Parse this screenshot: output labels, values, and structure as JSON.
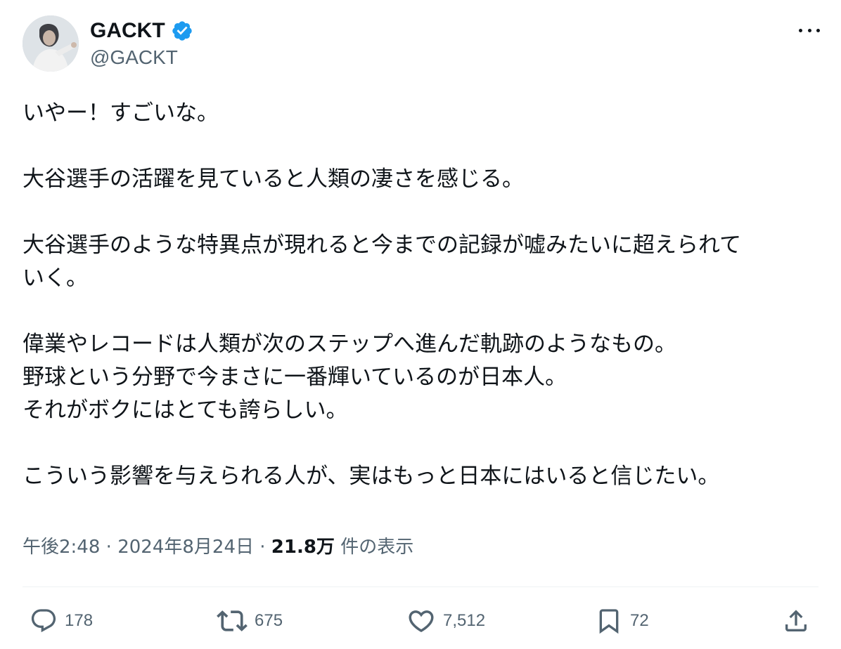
{
  "author": {
    "display_name": "GACKT",
    "handle": "@GACKT",
    "verified": true,
    "verified_color": "#1d9bf0"
  },
  "tweet": {
    "lines": [
      "いやー！すごいな。",
      "",
      "大谷選手の活躍を見ていると人類の凄さを感じる。",
      "",
      "大谷選手のような特異点が現れると今までの記録が嘘みたいに超えられて",
      "いく。",
      "",
      "偉業やレコードは人類が次のステップへ進んだ軌跡のようなもの。",
      "野球という分野で今まさに一番輝いているのが日本人。",
      "それがボクにはとても誇らしい。",
      "",
      "こういう影響を与えられる人が、実はもっと日本にはいると信じたい。"
    ]
  },
  "meta": {
    "time": "午後2:48",
    "separator1": " · ",
    "date": "2024年8月24日",
    "separator2": " · ",
    "views_count": "21.8万",
    "views_label": " 件の表示"
  },
  "actions": {
    "replies": "178",
    "reposts": "675",
    "likes": "7,512",
    "bookmarks": "72"
  },
  "icons": {
    "reply": "reply-icon",
    "repost": "repost-icon",
    "like": "heart-icon",
    "bookmark": "bookmark-icon",
    "share": "share-icon",
    "more": "more-icon"
  },
  "colors": {
    "text_primary": "#0f1419",
    "text_secondary": "#536471",
    "divider": "#eff3f4",
    "accent": "#1d9bf0"
  }
}
